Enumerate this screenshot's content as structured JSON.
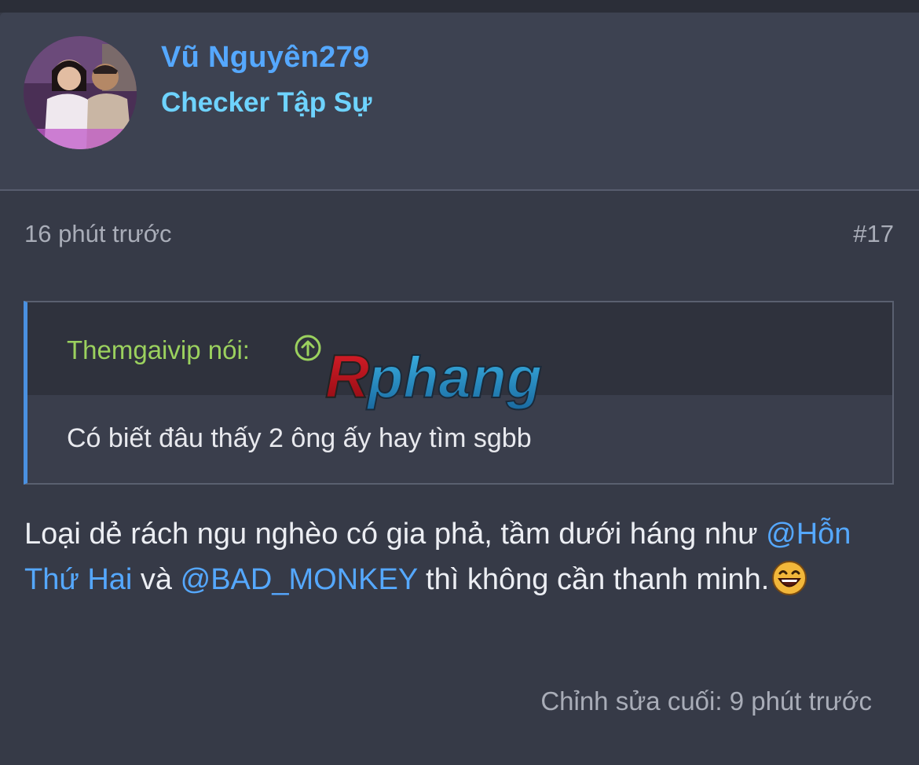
{
  "author": {
    "username": "Vũ Nguyên279",
    "title": "Checker Tập Sự",
    "avatar_icon": "user-avatar-photo"
  },
  "post": {
    "time": "16 phút trước",
    "number": "#17",
    "quote": {
      "author_label": "Themgaivip nói:",
      "arrow_icon": "circle-arrow-up-icon",
      "text": "Có biết đâu thấy 2 ông ấy hay tìm sgbb"
    },
    "body": {
      "part1": "Loại dẻ rách ngu nghèo có gia phả, tầm dưới háng như ",
      "mention1": "@Hỗn Thứ Hai",
      "part2": " và ",
      "mention2": "@BAD_MONKEY",
      "part3": " thì không cần thanh minh.",
      "emoji_icon": "laughing-emoji-icon"
    },
    "edit_note": "Chỉnh sửa cuối: 9 phút trước"
  },
  "watermark": {
    "text": "Rphang"
  },
  "colors": {
    "background": "#363a47",
    "card": "#3d4251",
    "username": "#55a8ff",
    "user_title": "#6ed3ff",
    "quote_author": "#9bd15e",
    "quote_border": "#4a90e0",
    "mention": "#55a8ff"
  }
}
